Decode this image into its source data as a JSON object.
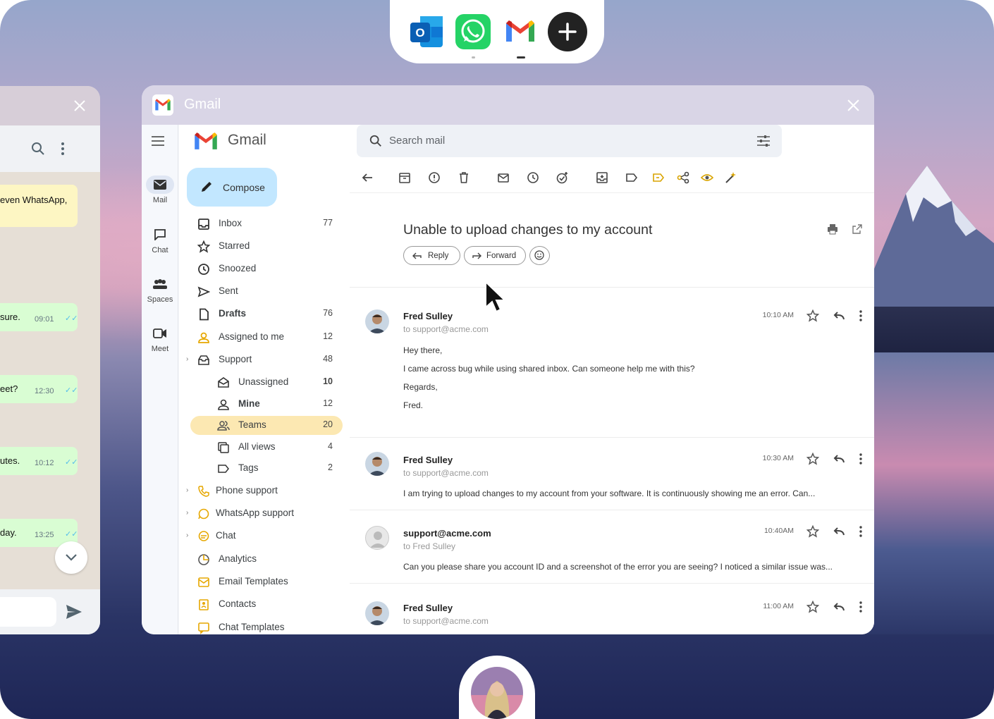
{
  "dock": {
    "apps": [
      {
        "name": "Outlook",
        "icon": "outlook-icon"
      },
      {
        "name": "WhatsApp",
        "icon": "whatsapp-icon"
      },
      {
        "name": "Gmail",
        "icon": "gmail-icon"
      }
    ],
    "add_icon": "plus-icon"
  },
  "whatsapp": {
    "messages": [
      {
        "text": "even WhatsApp,",
        "time": ""
      },
      {
        "text": "sure.",
        "time": "09:01"
      },
      {
        "text": "eet?",
        "time": "12:30"
      },
      {
        "text": "utes.",
        "time": "10:12"
      },
      {
        "text": "day.",
        "time": "13:25"
      }
    ]
  },
  "window": {
    "title": "Gmail"
  },
  "rail": [
    {
      "label": "Mail"
    },
    {
      "label": "Chat"
    },
    {
      "label": "Spaces"
    },
    {
      "label": "Meet"
    }
  ],
  "brand": "Gmail",
  "compose": "Compose",
  "search": {
    "placeholder": "Search mail"
  },
  "nav": [
    {
      "label": "Inbox",
      "count": "77"
    },
    {
      "label": "Starred",
      "count": ""
    },
    {
      "label": "Snoozed",
      "count": ""
    },
    {
      "label": "Sent",
      "count": ""
    },
    {
      "label": "Drafts",
      "count": "76"
    },
    {
      "label": "Assigned to me",
      "count": "12"
    },
    {
      "label": "Support",
      "count": "48"
    },
    {
      "label": "Unassigned",
      "count": "10"
    },
    {
      "label": "Mine",
      "count": "12"
    },
    {
      "label": "Teams",
      "count": "20"
    },
    {
      "label": "All views",
      "count": "4"
    },
    {
      "label": "Tags",
      "count": "2"
    },
    {
      "label": "Phone support",
      "count": ""
    },
    {
      "label": "WhatsApp support",
      "count": ""
    },
    {
      "label": "Chat",
      "count": ""
    },
    {
      "label": "Analytics",
      "count": ""
    },
    {
      "label": "Email Templates",
      "count": ""
    },
    {
      "label": "Contacts",
      "count": ""
    },
    {
      "label": "Chat Templates",
      "count": ""
    }
  ],
  "thread": {
    "subject": "Unable to upload changes to my account",
    "reply": "Reply",
    "forward": "Forward",
    "messages": [
      {
        "sender": "Fred Sulley",
        "to": "to support@acme.com",
        "time": "10:10 AM",
        "lines": [
          "Hey there,",
          "I came across bug while using shared inbox. Can someone help me with this?",
          "Regards,",
          "Fred."
        ]
      },
      {
        "sender": "Fred Sulley",
        "to": "to support@acme.com",
        "time": "10:30 AM",
        "lines": [
          "I am trying to upload changes to my account from your software. It is continuously showing me an error. Can..."
        ]
      },
      {
        "sender": "support@acme.com",
        "to": "to Fred Sulley",
        "time": "10:40AM",
        "lines": [
          "Can you please share you account ID and a screenshot of the error you are seeing? I noticed a similar issue was..."
        ]
      },
      {
        "sender": "Fred Sulley",
        "to": "to support@acme.com",
        "time": "11:00 AM",
        "lines": []
      }
    ]
  }
}
